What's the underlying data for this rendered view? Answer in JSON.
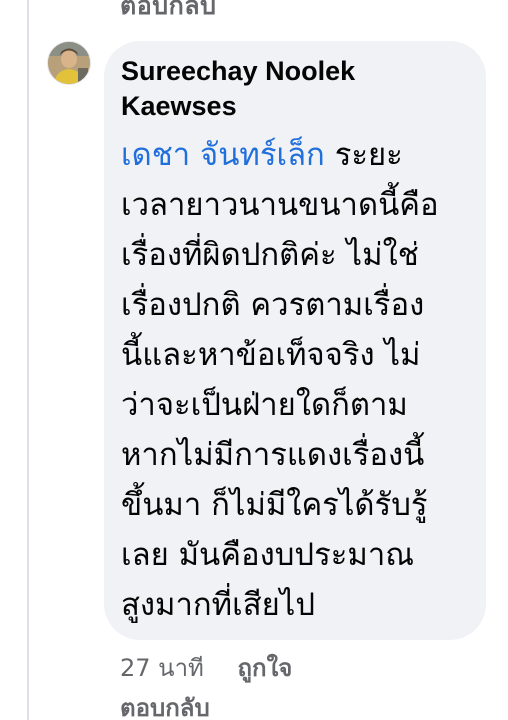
{
  "previous_comment": {
    "reply_label": "ตอบกลับ"
  },
  "comment": {
    "author": "Sureechay Noolek Kaewses",
    "mention": "เดชา จันทร์เล็ก",
    "text_lines": [
      "ระยะ",
      "เวลายาวนานขนาดนี้คือ",
      "เรื่องที่ผิดปกติค่ะ ไม่ใช่",
      "เรื่องปกติ ควรตามเรื่อง",
      "นี้และหาข้อเท็จจริง ไม่",
      "ว่าจะเป็นฝ่ายใดก็ตาม",
      "หากไม่มีการแดงเรื่องนี้",
      "ขึ้นมา ก็ไม่มีใครได้รับรู้",
      "เลย มันคืองบประมาณ",
      "สูงมากที่เสียไป"
    ],
    "time": "27 นาที",
    "like_label": "ถูกใจ",
    "reply_label": "ตอบกลับ"
  }
}
